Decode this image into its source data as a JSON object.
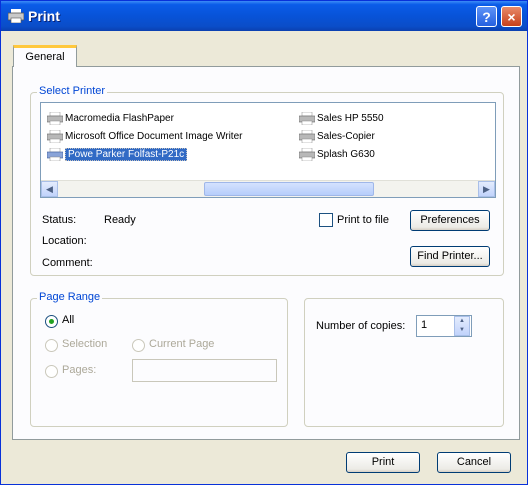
{
  "window": {
    "title": "Print",
    "help_glyph": "?",
    "close_glyph": "×"
  },
  "tabs": [
    {
      "label": "General",
      "active": true
    }
  ],
  "select_printer": {
    "title": "Select Printer",
    "printers": [
      {
        "name": "Macromedia FlashPaper",
        "selected": false
      },
      {
        "name": "Microsoft Office Document Image Writer",
        "selected": false
      },
      {
        "name": "Powe Parker Folfast-P21c",
        "selected": true
      },
      {
        "name": "Sales HP 5550",
        "selected": false
      },
      {
        "name": "Sales-Copier",
        "selected": false
      },
      {
        "name": "Splash G630",
        "selected": false
      }
    ],
    "status_label": "Status:",
    "status_value": "Ready",
    "location_label": "Location:",
    "comment_label": "Comment:",
    "print_to_file_label": "Print to file",
    "print_to_file_checked": false,
    "preferences_label": "Preferences",
    "find_printer_label": "Find Printer..."
  },
  "page_range": {
    "title": "Page Range",
    "all_label": "All",
    "selection_label": "Selection",
    "current_page_label": "Current Page",
    "pages_label": "Pages:",
    "pages_value": "",
    "selected_option": "All"
  },
  "copies": {
    "label": "Number of copies:",
    "value": "1"
  },
  "footer": {
    "print_label": "Print",
    "cancel_label": "Cancel"
  },
  "scroll": {
    "left_glyph": "◀",
    "right_glyph": "▶",
    "up_glyph": "▲",
    "down_glyph": "▼"
  },
  "colors": {
    "title_bar": "#0853d8",
    "group_title": "#0046d5",
    "selection": "#316ac5",
    "radio_dot": "#21a121"
  }
}
